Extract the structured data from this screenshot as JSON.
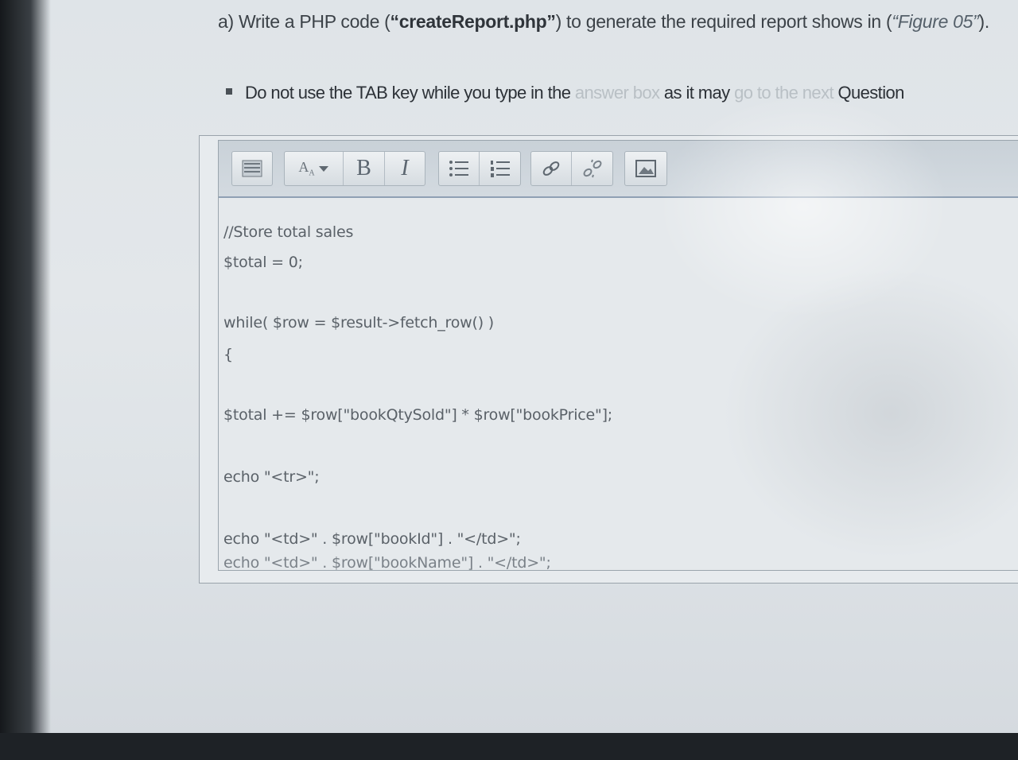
{
  "question": {
    "prefix": "a) Write a PHP code (",
    "filename": "“createReport.php”",
    "suffix": ") to generate the required report shows in (",
    "figure": "“Figure 05”",
    "end": ")."
  },
  "instruction": {
    "text_main": "Do not use the TAB key while you type in the ",
    "text_faded1": "answer box",
    "text_mid": " as it may ",
    "text_faded2": "go to the next",
    "text_end": " Question"
  },
  "toolbar": {
    "buttons": [
      {
        "name": "toggle-toolbar-icon",
        "glyph": "keyboard"
      },
      {
        "name": "font-size-dropdown-icon",
        "glyph": "A↓"
      },
      {
        "name": "bold-icon",
        "glyph": "B"
      },
      {
        "name": "italic-icon",
        "glyph": "I"
      },
      {
        "name": "unordered-list-icon",
        "glyph": "list"
      },
      {
        "name": "ordered-list-icon",
        "glyph": "numbered-list"
      },
      {
        "name": "link-icon",
        "glyph": "link"
      },
      {
        "name": "unlink-icon",
        "glyph": "unlink"
      },
      {
        "name": "image-icon",
        "glyph": "image"
      }
    ],
    "bold_label": "B",
    "italic_label": "I",
    "font_label": "A"
  },
  "editor": {
    "lines": [
      "//Store total sales",
      "$total = 0;",
      "",
      "while( $row = $result->fetch_row() )",
      "{",
      "",
      "$total += $row[\"bookQtySold\"] * $row[\"bookPrice\"];",
      "",
      "echo \"<tr>\";",
      "",
      "echo \"<td>\" . $row[\"bookId\"] . \"</td>\";",
      "echo \"<td>\" . $row[\"bookName\"] . \"</td>\";"
    ]
  }
}
